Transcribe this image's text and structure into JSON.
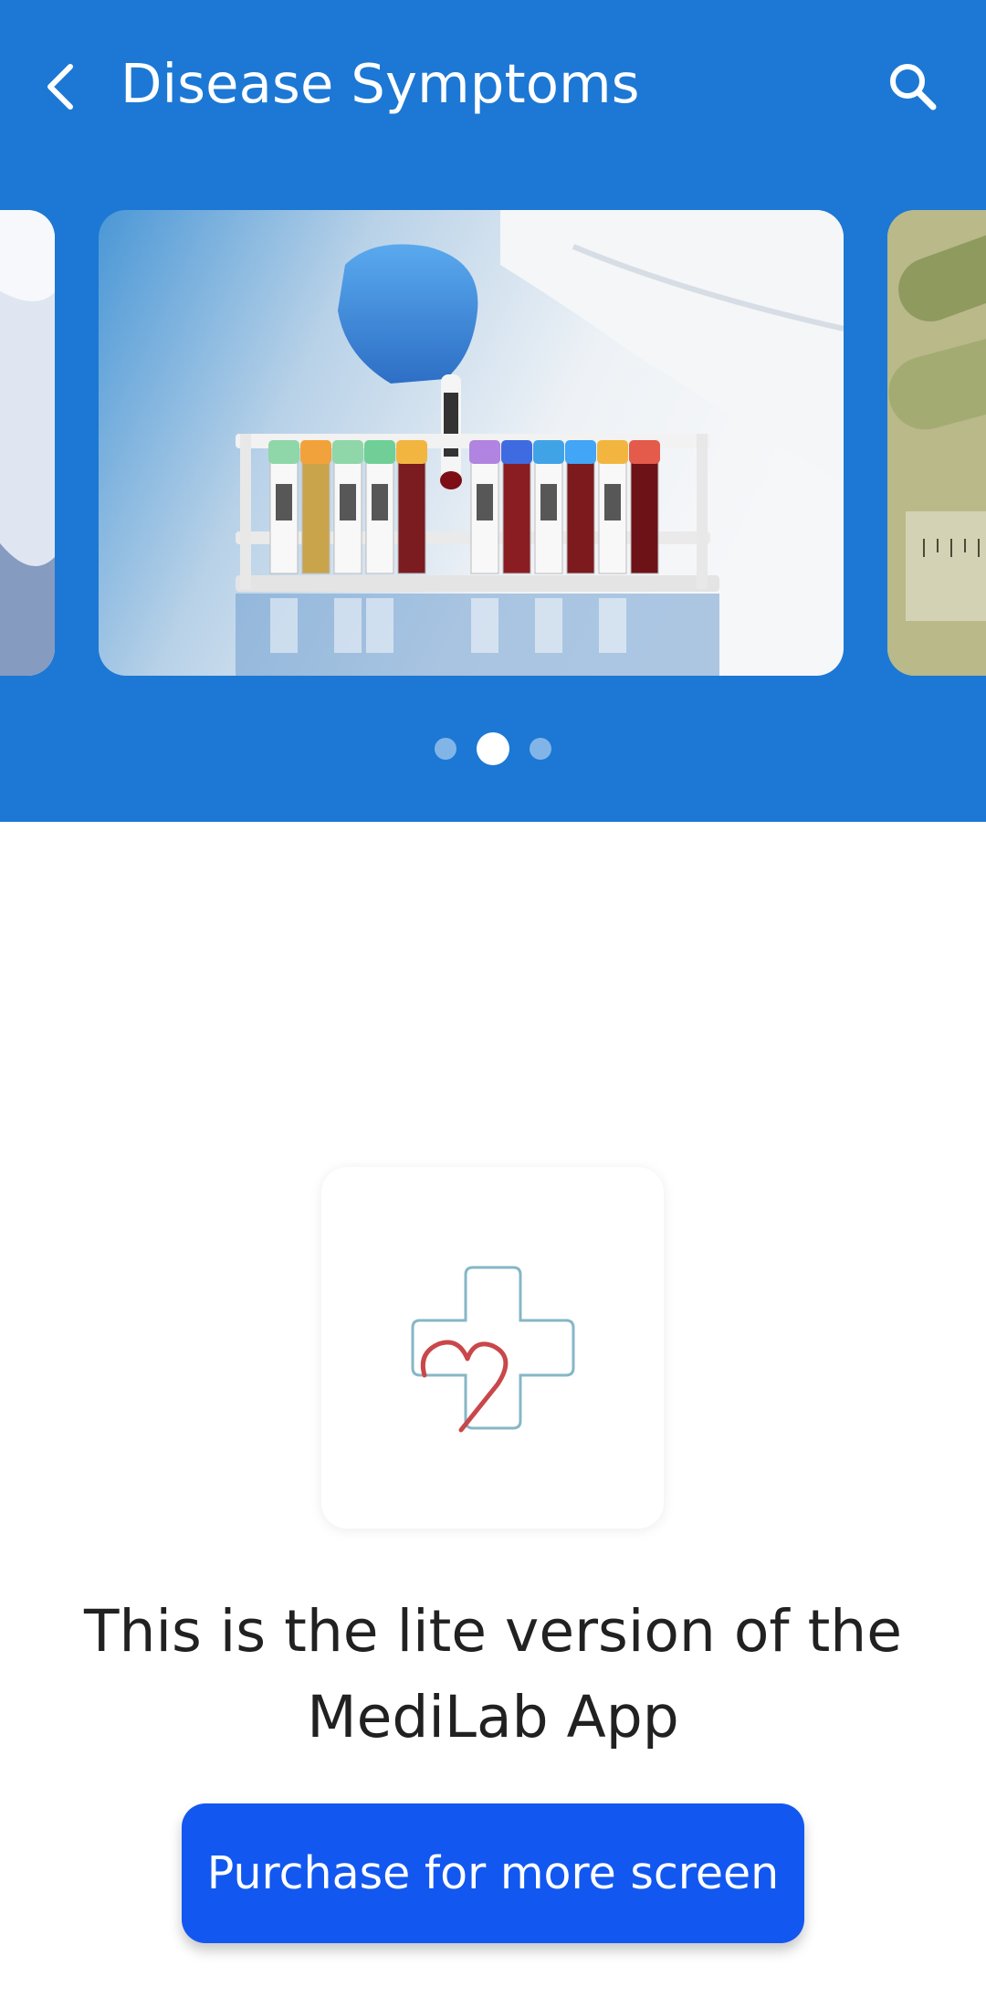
{
  "app_bar": {
    "title": "Disease Symptoms",
    "back_icon": "chevron-left-icon",
    "search_icon": "search-icon"
  },
  "carousel": {
    "slides": [
      {
        "name": "doctor-coat-slide",
        "description": "partial"
      },
      {
        "name": "blood-test-tubes-slide",
        "description": "gloved hand lifting a sample tube from a rack of test tubes"
      },
      {
        "name": "pills-slide",
        "description": "partial"
      }
    ],
    "active_index": 1,
    "dot_count": 3
  },
  "logo": {
    "icon": "medical-cross-heart-icon",
    "cross_color": "#86b7c6",
    "heart_color": "#c9474a"
  },
  "message": {
    "line1": "This is the lite version of the",
    "line2": "MediLab App"
  },
  "purchase_button": {
    "label": "Purchase for more screen"
  },
  "colors": {
    "header": "#1c78d4",
    "button": "#1257f0"
  }
}
